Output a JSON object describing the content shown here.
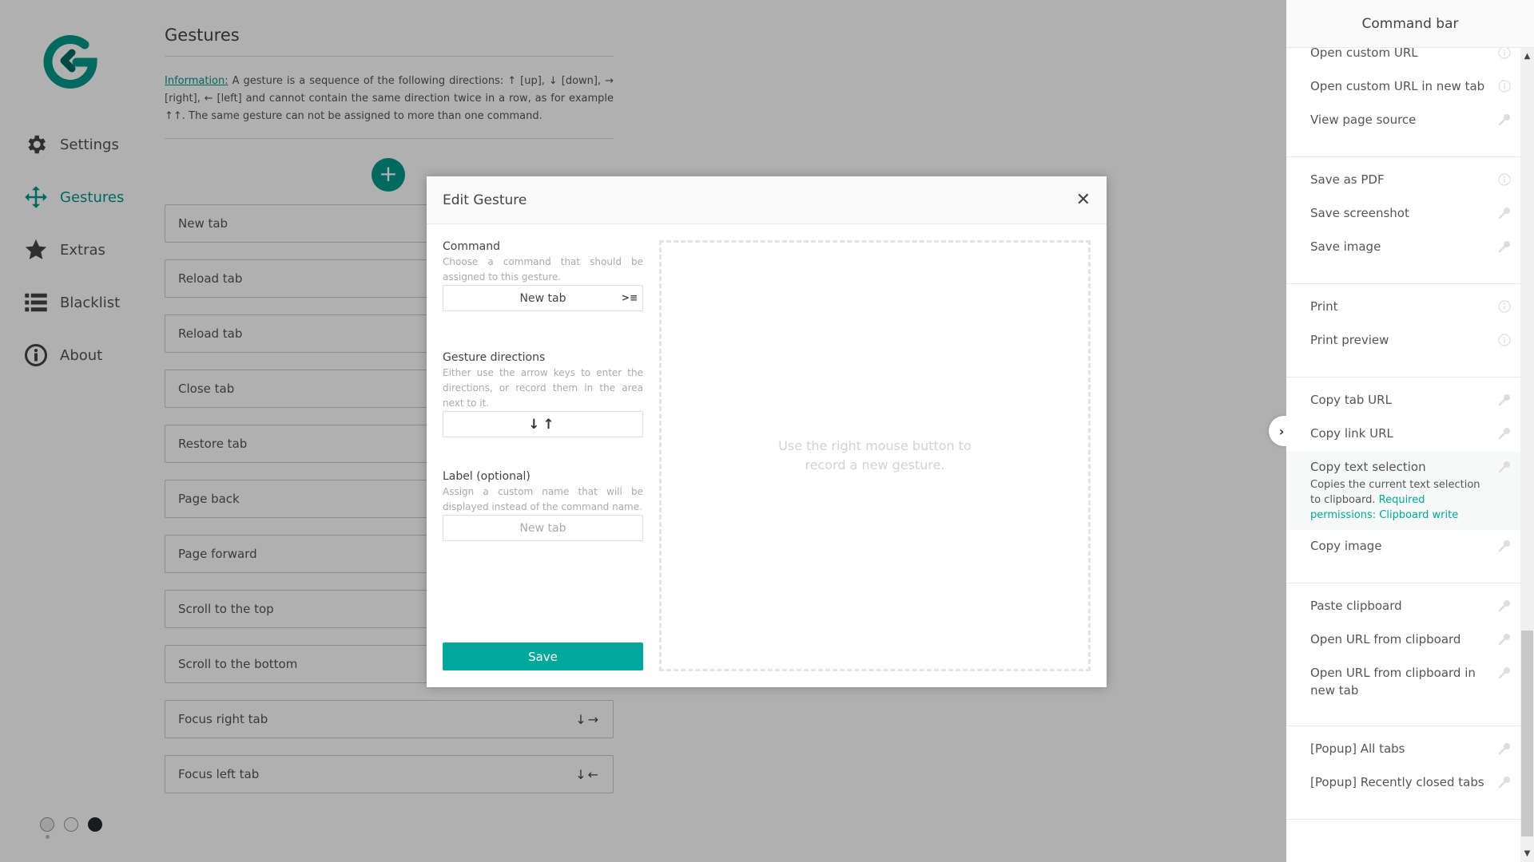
{
  "sidebar": {
    "logo": "gesturefy-logo",
    "items": [
      {
        "label": "Settings",
        "icon": "gear-icon",
        "active": false
      },
      {
        "label": "Gestures",
        "icon": "move-arrows-icon",
        "active": true
      },
      {
        "label": "Extras",
        "icon": "star-icon",
        "active": false
      },
      {
        "label": "Blacklist",
        "icon": "list-icon",
        "active": false
      },
      {
        "label": "About",
        "icon": "info-circle-icon",
        "active": false
      }
    ],
    "theme_options": [
      "default",
      "highContrast",
      "dark"
    ]
  },
  "main": {
    "title": "Gestures",
    "info_label": "Information:",
    "info_text": " A gesture is a sequence of the following directions: ↑ [up], ↓ [down], → [right], ← [left] and cannot contain the same direction twice in a row, as for example ↑↑. The same gesture can not be assigned to more than one command.",
    "add_button": "+",
    "gestures": [
      {
        "label": "New tab",
        "directions": ""
      },
      {
        "label": "Reload tab",
        "directions": ""
      },
      {
        "label": "Reload tab",
        "directions": ""
      },
      {
        "label": "Close tab",
        "directions": ""
      },
      {
        "label": "Restore tab",
        "directions": ""
      },
      {
        "label": "Page back",
        "directions": ""
      },
      {
        "label": "Page forward",
        "directions": ""
      },
      {
        "label": "Scroll to the top",
        "directions": ""
      },
      {
        "label": "Scroll to the bottom",
        "directions": ""
      },
      {
        "label": "Focus right tab",
        "directions": "↓→"
      },
      {
        "label": "Focus left tab",
        "directions": "↓←"
      }
    ]
  },
  "modal": {
    "title": "Edit Gesture",
    "close": "✕",
    "command": {
      "label": "Command",
      "description": "Choose a command that should be assigned to this gesture.",
      "value": "New tab",
      "icon": "command-select-icon"
    },
    "directions": {
      "label": "Gesture directions",
      "description": "Either use the arrow keys to enter the directions, or record them in the area next to it.",
      "value": "↓↑"
    },
    "custom_label": {
      "label": "Label (optional)",
      "description": "Assign a custom name that will be displayed instead of the command name.",
      "placeholder": "New tab",
      "value": ""
    },
    "save_button": "Save",
    "record_hint": "Use the right mouse button to record a new gesture."
  },
  "command_bar": {
    "title": "Command bar",
    "groups": [
      {
        "items": [
          {
            "label": "Open custom URL",
            "icon": "info-icon",
            "partial": true
          },
          {
            "label": "Open custom URL in new tab",
            "icon": "info-icon"
          },
          {
            "label": "View page source",
            "icon": "key-icon"
          }
        ]
      },
      {
        "items": [
          {
            "label": "Save as PDF",
            "icon": "info-icon"
          },
          {
            "label": "Save screenshot",
            "icon": "key-icon"
          },
          {
            "label": "Save image",
            "icon": "key-icon"
          }
        ]
      },
      {
        "items": [
          {
            "label": "Print",
            "icon": "info-icon"
          },
          {
            "label": "Print preview",
            "icon": "info-icon"
          }
        ]
      },
      {
        "items": [
          {
            "label": "Copy tab URL",
            "icon": "key-icon"
          },
          {
            "label": "Copy link URL",
            "icon": "key-icon"
          },
          {
            "label": "Copy text selection",
            "icon": "key-icon",
            "expanded": true,
            "description": "Copies the current text selection to clipboard.",
            "permissions": "Required permissions: Clipboard write"
          },
          {
            "label": "Copy image",
            "icon": "key-icon"
          }
        ]
      },
      {
        "items": [
          {
            "label": "Paste clipboard",
            "icon": "key-icon"
          },
          {
            "label": "Open URL from clipboard",
            "icon": "key-icon"
          },
          {
            "label": "Open URL from clipboard in new tab",
            "icon": "key-icon"
          }
        ]
      },
      {
        "items": [
          {
            "label": "[Popup] All tabs",
            "icon": "key-icon"
          },
          {
            "label": "[Popup] Recently closed tabs",
            "icon": "key-icon"
          }
        ]
      }
    ],
    "collapse_icon": "›",
    "colors": {
      "accent": "#00a79a"
    }
  },
  "colors": {
    "accent": "#00998a",
    "save_button": "#00a79a",
    "overlay": "rgba(0,0,0,0.31)"
  }
}
